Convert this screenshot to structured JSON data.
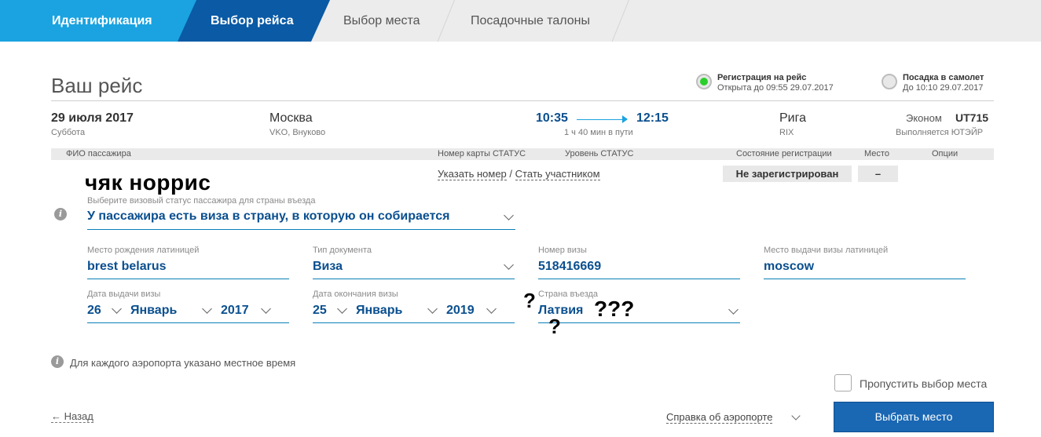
{
  "steps": [
    "Идентификация",
    "Выбор рейса",
    "Выбор места",
    "Посадочные талоны"
  ],
  "header": {
    "title": "Ваш рейс",
    "checkin": {
      "title": "Регистрация на рейс",
      "sub": "Открыта до 09:55 29.07.2017"
    },
    "boarding": {
      "title": "Посадка в самолет",
      "sub": "До 10:10 29.07.2017"
    }
  },
  "flight": {
    "date": "29 июля 2017",
    "weekday": "Суббота",
    "from_city": "Москва",
    "from_airport": "VKO, Внуково",
    "dep_time": "10:35",
    "arr_time": "12:15",
    "duration": "1 ч 40 мин в пути",
    "to_city": "Рига",
    "to_airport": "RIX",
    "class": "Эконом",
    "number": "UT715",
    "operator": "Выполняется ЮТЭЙР"
  },
  "table": {
    "headers": [
      "ФИО пассажира",
      "Номер карты СТАТУС",
      "Уровень СТАТУС",
      "Состояние регистрации",
      "Место",
      "Опции"
    ]
  },
  "passenger": {
    "name": "чяк норрис",
    "card_link": "Указать номер",
    "separator": "/",
    "member_link": "Стать участником",
    "reg_status": "Не зарегистрирован",
    "seat": "–"
  },
  "visa_status": {
    "label": "Выберите визовый статус пассажира для страны въезда",
    "value": "У пассажира есть виза в страну, в которую он собирается"
  },
  "form": {
    "birthplace": {
      "label": "Место рождения латиницей",
      "value": "brest belarus"
    },
    "doc_type": {
      "label": "Тип документа",
      "value": "Виза"
    },
    "visa_number": {
      "label": "Номер визы",
      "value": "518416669"
    },
    "visa_place": {
      "label": "Место выдачи визы латиницей",
      "value": "moscow"
    },
    "issue_date": {
      "label": "Дата выдачи визы",
      "day": "26",
      "month": "Январь",
      "year": "2017"
    },
    "expiry_date": {
      "label": "Дата окончания визы",
      "day": "25",
      "month": "Январь",
      "year": "2019"
    },
    "entry_country": {
      "label": "Страна въезда",
      "value": "Латвия"
    }
  },
  "marks": {
    "q1": "?",
    "q2": "???",
    "q3": "?"
  },
  "footer": {
    "timezone_note": "Для каждого аэропорта указано местное время",
    "skip_seat": "Пропустить выбор места",
    "back": "← Назад",
    "airport_info": "Справка об аэропорте",
    "choose_seat": "Выбрать место"
  },
  "colors": {
    "step_active": "#0a5aa5",
    "step_done": "#1aa3e0",
    "value": "#0a4f8f",
    "button": "#1a67b3",
    "radio_on": "#2bcf2b"
  }
}
